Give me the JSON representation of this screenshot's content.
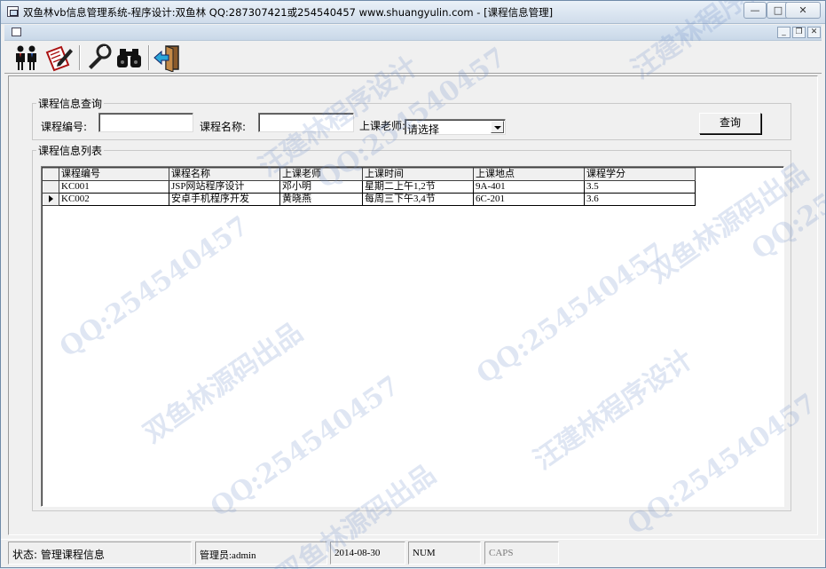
{
  "window": {
    "title": "双鱼林vb信息管理系统-程序设计:双鱼林 QQ:287307421或254540457 www.shuangyulin.com - [课程信息管理]",
    "min_glyph": "—",
    "max_glyph": "□",
    "close_glyph": "✕"
  },
  "mdi": {
    "min_glyph": "_",
    "max_glyph": "❐",
    "close_glyph": "✕"
  },
  "toolbar": {
    "items": [
      {
        "icon": "users-icon"
      },
      {
        "icon": "edit-notes-icon"
      },
      {
        "icon": "wrench-icon"
      },
      {
        "icon": "binoculars-icon"
      },
      {
        "icon": "exit-door-icon"
      }
    ]
  },
  "query": {
    "group_title": "课程信息查询",
    "course_no_label": "课程编号:",
    "course_no_value": "",
    "course_name_label": "课程名称:",
    "course_name_value": "",
    "teacher_label": "上课老师:",
    "teacher_value": "请选择",
    "search_label": "查询"
  },
  "list": {
    "group_title": "课程信息列表",
    "columns": [
      "课程编号",
      "课程名称",
      "上课老师",
      "上课时间",
      "上课地点",
      "课程学分"
    ],
    "rows": [
      [
        "KC001",
        "JSP网站程序设计",
        "邓小明",
        "星期二上午1,2节",
        "9A-401",
        "3.5"
      ],
      [
        "KC002",
        "安卓手机程序开发",
        "黄晓燕",
        "每周三下午3,4节",
        "6C-201",
        "3.6"
      ]
    ],
    "current_row": 1
  },
  "status": {
    "state": "状态: 管理课程信息",
    "user": "管理员:admin",
    "date": "2014-08-30",
    "num": "NUM",
    "caps": "CAPS"
  },
  "watermark": {
    "texts": [
      "QQ:254540457",
      "汪建林程序设计",
      "双鱼林源码出品"
    ]
  }
}
